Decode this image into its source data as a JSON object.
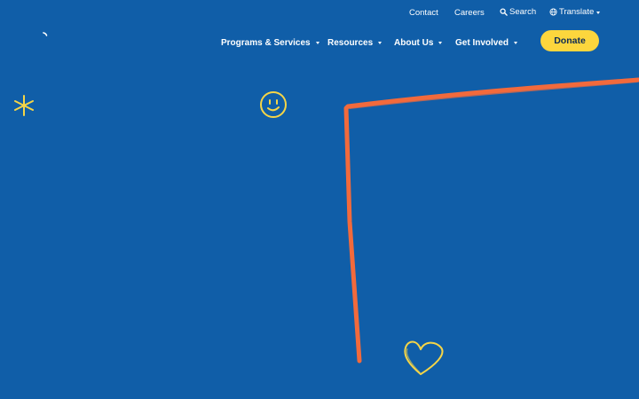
{
  "utility_nav": {
    "contact": "Contact",
    "careers": "Careers",
    "search": "Search",
    "translate": "Translate"
  },
  "main_nav": {
    "programs": "Programs & Services",
    "resources": "Resources",
    "about": "About Us",
    "get_involved": "Get Involved"
  },
  "donate": {
    "label": "Donate"
  },
  "colors": {
    "background": "#105ea8",
    "donate": "#fcd63d",
    "accent_orange": "#f26a3c",
    "accent_yellow": "#f5d547"
  },
  "icons": [
    "search-icon",
    "globe-icon",
    "chevron-down-icon",
    "asterisk-doodle-icon",
    "smiley-doodle-icon",
    "heart-doodle-icon"
  ]
}
